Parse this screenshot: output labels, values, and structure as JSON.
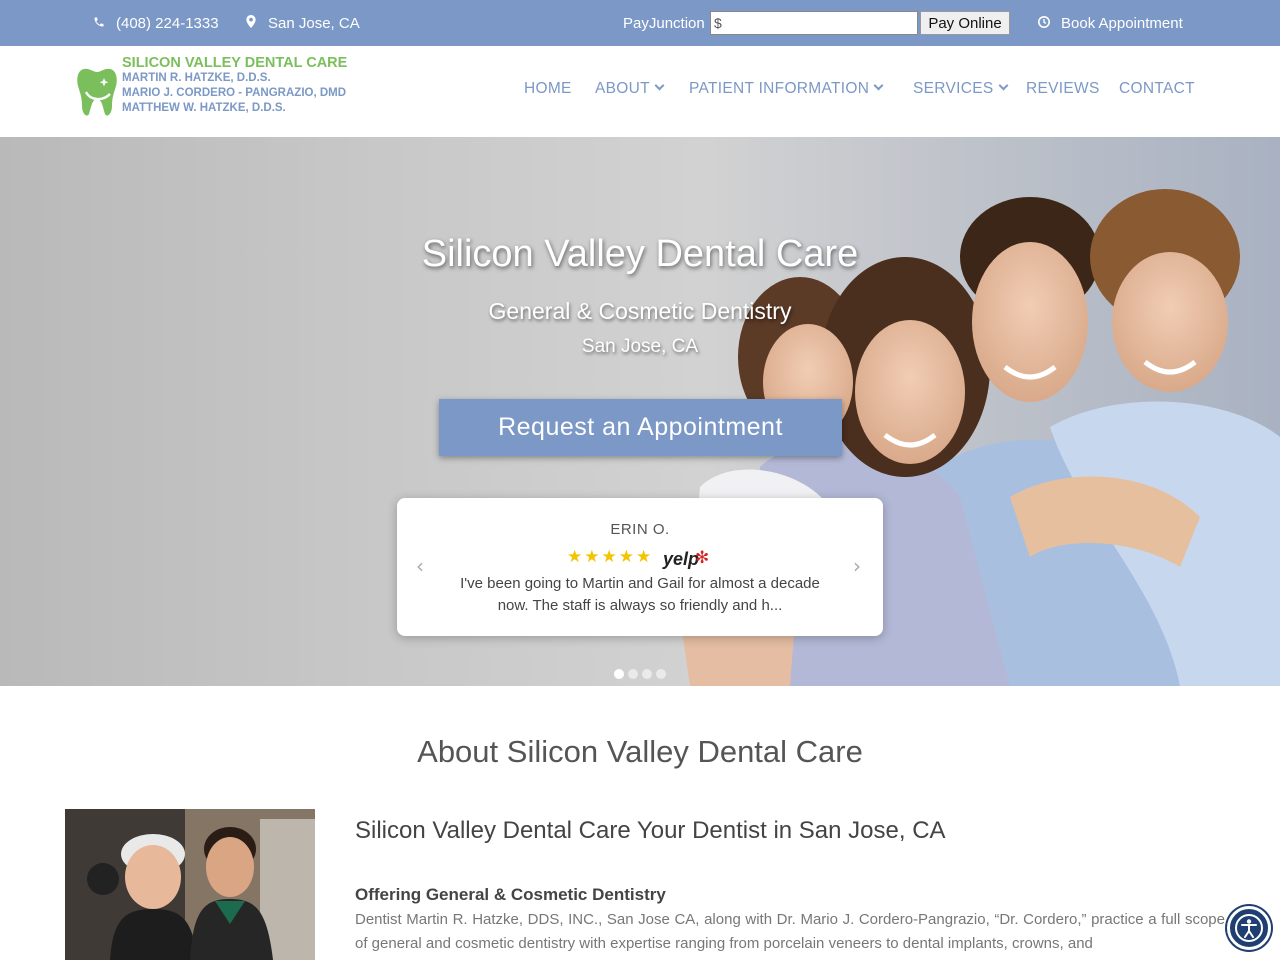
{
  "topbar": {
    "phone": "(408) 224-1333",
    "location": "San Jose, CA",
    "payjunction_label": "PayJunction",
    "pay_amount_value": "$",
    "pay_button": "Pay Online",
    "book": "Book Appointment"
  },
  "logo": {
    "title": "SILICON VALLEY DENTAL CARE",
    "lines": [
      "MARTIN R. HATZKE, D.D.S.",
      "MARIO J. CORDERO - PANGRAZIO, DMD",
      "MATTHEW W. HATZKE, D.D.S."
    ]
  },
  "nav": {
    "items": [
      {
        "label": "HOME"
      },
      {
        "label": "ABOUT"
      },
      {
        "label": "PATIENT INFORMATION"
      },
      {
        "label": "SERVICES"
      },
      {
        "label": "REVIEWS"
      },
      {
        "label": "CONTACT"
      }
    ]
  },
  "hero": {
    "title": "Silicon Valley Dental Care",
    "subtitle": "General & Cosmetic Dentistry",
    "location": "San Jose, CA",
    "cta": "Request an Appointment",
    "review": {
      "name": "ERIN O.",
      "rating": 5,
      "source": "yelp",
      "text": "I've been going to Martin and Gail for almost a decade now. The staff is always so friendly and h..."
    },
    "slides": 4,
    "active_slide": 1
  },
  "about": {
    "title": "About Silicon Valley Dental Care",
    "heading": "Silicon Valley Dental Care Your Dentist in San Jose, CA",
    "subheading": "Offering General & Cosmetic Dentistry",
    "paragraph": "Dentist Martin R. Hatzke, DDS, INC., San Jose CA, along with Dr. Mario J. Cordero-Pangrazio, “Dr. Cordero,” practice a full scope of general and cosmetic dentistry with expertise ranging from porcelain veneers to dental implants, crowns, and"
  },
  "colors": {
    "brand_blue": "#7b98c6",
    "brand_green": "#7bbf5d",
    "star": "#f3c400",
    "yelp_red": "#d32323"
  },
  "icons": [
    "phone-icon",
    "map-pin-icon",
    "clock-icon",
    "tooth-logo-icon",
    "chevron-down-icon",
    "star-icon",
    "yelp-logo",
    "chevron-left-icon",
    "chevron-right-icon",
    "accessibility-icon"
  ]
}
